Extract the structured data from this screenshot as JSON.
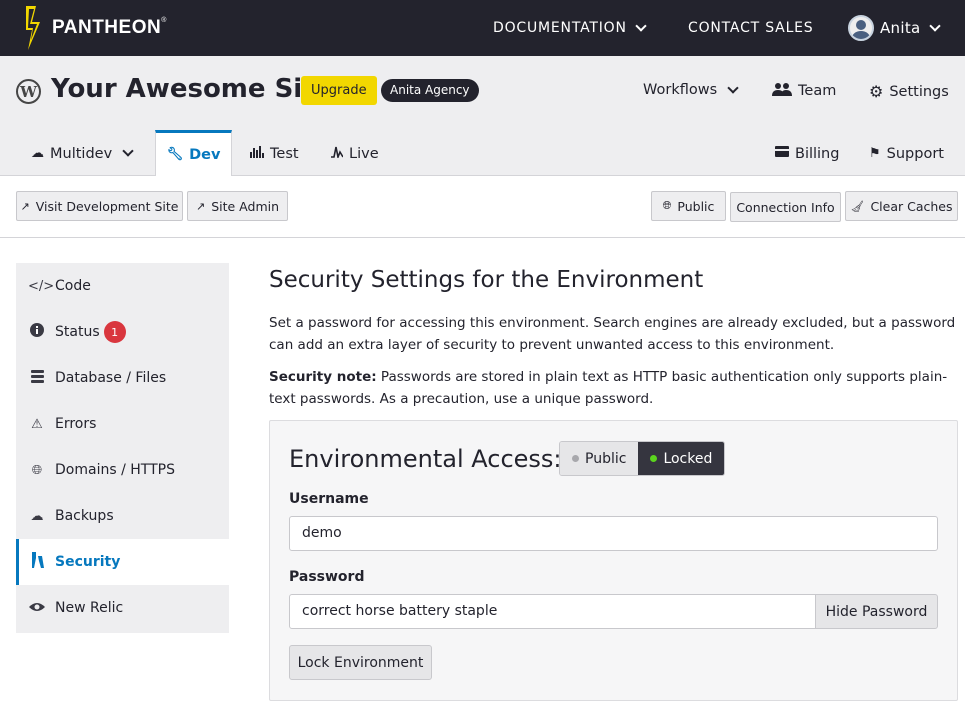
{
  "topbar": {
    "logo_text": "PANTHEON",
    "logo_mark": "®",
    "documentation": "DOCUMENTATION",
    "contact_sales": "CONTACT SALES",
    "user_name": "Anita"
  },
  "site": {
    "title": "Your Awesome Site",
    "upgrade_label": "Upgrade",
    "agency_label": "Anita Agency",
    "workflows": "Workflows",
    "team": "Team",
    "settings": "Settings"
  },
  "env_tabs": {
    "multidev": "Multidev",
    "dev": "Dev",
    "test": "Test",
    "live": "Live",
    "billing": "Billing",
    "support": "Support"
  },
  "actions": {
    "visit": "Visit Development Site",
    "site_admin": "Site Admin",
    "public": "Public",
    "connection_info": "Connection Info",
    "clear_caches": "Clear Caches"
  },
  "sidebar": {
    "items": [
      {
        "label": "Code",
        "icon": "code-icon"
      },
      {
        "label": "Status",
        "icon": "info-icon",
        "badge": "1"
      },
      {
        "label": "Database / Files",
        "icon": "database-icon"
      },
      {
        "label": "Errors",
        "icon": "warning-icon"
      },
      {
        "label": "Domains / HTTPS",
        "icon": "globe-icon"
      },
      {
        "label": "Backups",
        "icon": "cloud-upload-icon"
      },
      {
        "label": "Security",
        "icon": "security-icon"
      },
      {
        "label": "New Relic",
        "icon": "eye-icon"
      }
    ],
    "active_index": 6
  },
  "main": {
    "title": "Security Settings for the Environment",
    "intro": "Set a password for accessing this environment. Search engines are already excluded, but a password can add an extra layer of security to prevent unwanted access to this environment.",
    "note_label": "Security note:",
    "note_text": " Passwords are stored in plain text as HTTP basic authentication only supports plain-text passwords. As a precaution, use a unique password."
  },
  "access": {
    "title": "Environmental Access:",
    "public_label": "Public",
    "locked_label": "Locked",
    "selected": "Locked",
    "username_label": "Username",
    "username_value": "demo",
    "password_label": "Password",
    "password_value": "correct horse battery staple",
    "hide_password": "Hide Password",
    "lock_button": "Lock Environment"
  },
  "colors": {
    "topbar": "#23232d",
    "accent_blue": "#0678be",
    "upgrade_yellow": "#f2d700",
    "badge_red": "#d9363e",
    "locked_green": "#5bd41e"
  }
}
